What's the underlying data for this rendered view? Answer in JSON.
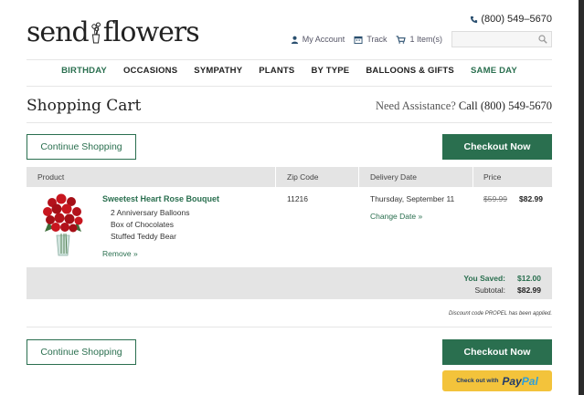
{
  "header": {
    "logo_left": "send",
    "logo_right": "flowers",
    "phone": "(800) 549–5670",
    "my_account": "My Account",
    "track": "Track",
    "cart": "1 Item(s)",
    "search_placeholder": ""
  },
  "nav": {
    "items": [
      "BIRTHDAY",
      "OCCASIONS",
      "SYMPATHY",
      "PLANTS",
      "BY TYPE",
      "BALLOONS & GIFTS",
      "SAME DAY"
    ]
  },
  "page": {
    "title": "Shopping Cart",
    "assist_label": "Need Assistance?",
    "assist_phone": "Call (800) 549-5670"
  },
  "buttons": {
    "continue": "Continue Shopping",
    "checkout": "Checkout Now",
    "paypal_label": "Check out with",
    "paypal_pay": "Pay",
    "paypal_pal": "Pal"
  },
  "table": {
    "headers": [
      "Product",
      "Zip Code",
      "Delivery Date",
      "Price"
    ]
  },
  "item": {
    "name": "Sweetest Heart Rose Bouquet",
    "addons": [
      "2 Anniversary Balloons",
      "Box of Chocolates",
      "Stuffed Teddy Bear"
    ],
    "remove": "Remove »",
    "zip": "11216",
    "delivery_date": "Thursday, September 11",
    "change_date": "Change Date »",
    "old_price": "$59.99",
    "price": "$82.99"
  },
  "totals": {
    "saved_label": "You Saved:",
    "saved_value": "$12.00",
    "subtotal_label": "Subtotal:",
    "subtotal_value": "$82.99"
  },
  "discount_note": "Discount code PROPEL has been applied.",
  "colors": {
    "brand_green": "#2a6f4f",
    "paypal_yellow": "#f3c33b"
  }
}
